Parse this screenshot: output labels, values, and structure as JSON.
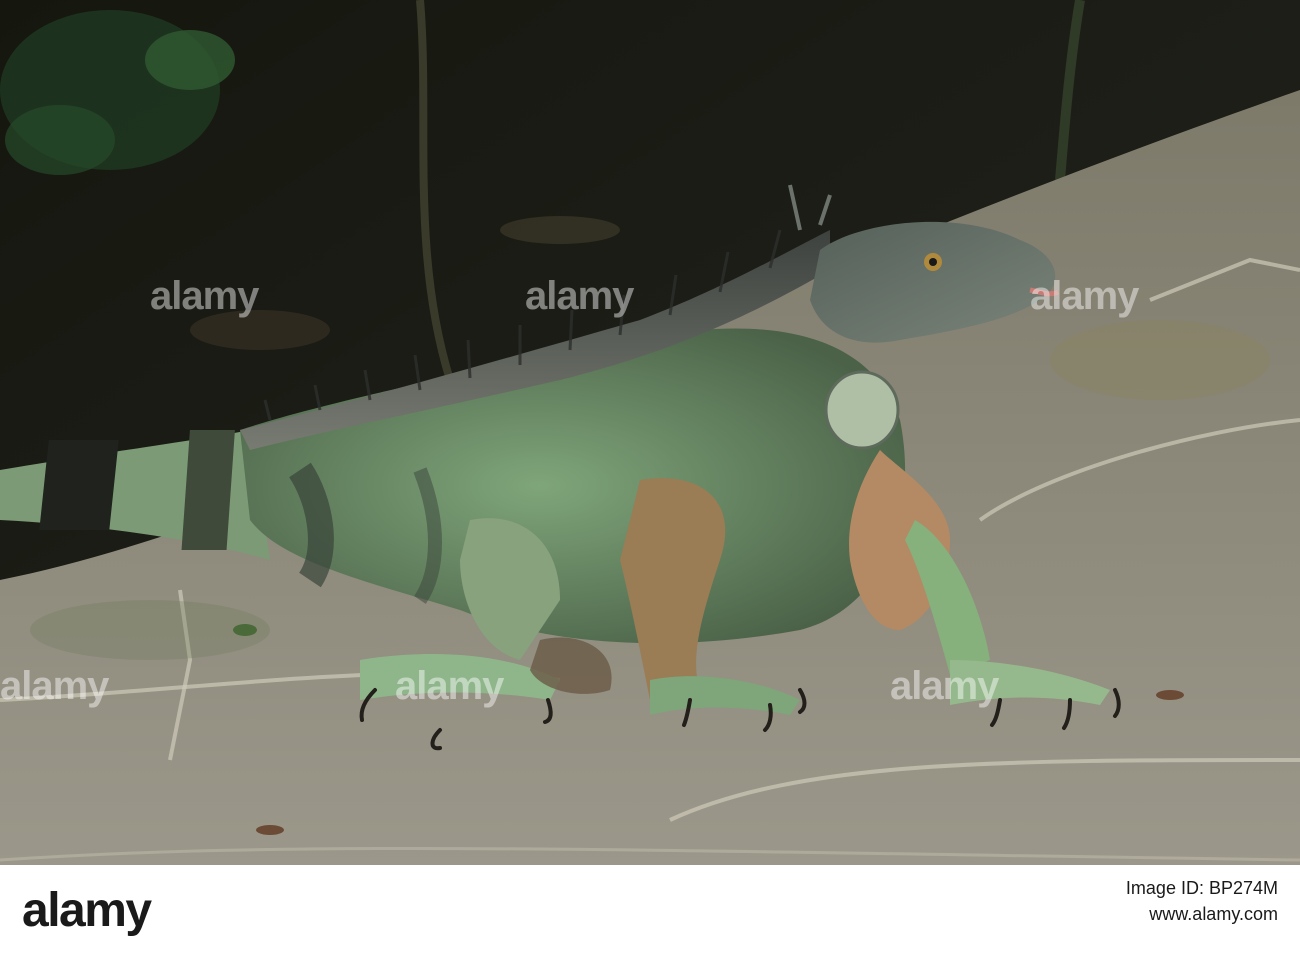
{
  "photo": {
    "subject": "iguana",
    "colors": {
      "background": "#1b1c16",
      "stone": "#8e8b7c",
      "body_green": "#6f8f6c",
      "crest_gray": "#5b5e5a"
    }
  },
  "watermark": {
    "text": "alamy"
  },
  "footer": {
    "logo": "alamy",
    "meta_line1": "www.alamy.com",
    "meta_line2": "Image ID: BP274M"
  }
}
